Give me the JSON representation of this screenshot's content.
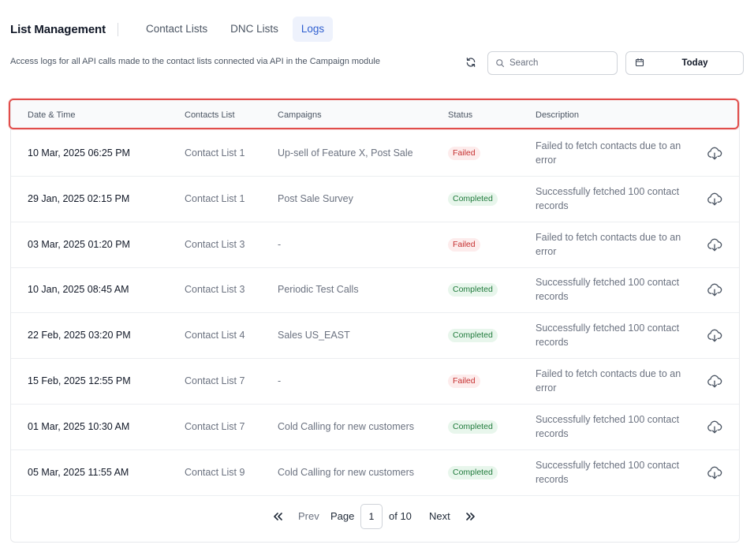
{
  "header": {
    "title": "List Management",
    "tabs": [
      {
        "label": "Contact Lists",
        "active": false
      },
      {
        "label": "DNC Lists",
        "active": false
      },
      {
        "label": "Logs",
        "active": true
      }
    ]
  },
  "subtitle": "Access logs for all API calls made to the contact lists connected via API in the Campaign module",
  "toolbar": {
    "refresh_icon": "refresh-icon",
    "search": {
      "placeholder": "Search",
      "value": ""
    },
    "date_filter": {
      "label": "Today"
    }
  },
  "table": {
    "columns": [
      "Date & Time",
      "Contacts List",
      "Campaigns",
      "Status",
      "Description"
    ],
    "rows": [
      {
        "datetime": "10 Mar, 2025 06:25 PM",
        "list": "Contact List 1",
        "campaigns": "Up-sell of Feature X, Post Sale",
        "status": "Failed",
        "description": "Failed to fetch contacts due to an error"
      },
      {
        "datetime": "29 Jan, 2025 02:15 PM",
        "list": "Contact List 1",
        "campaigns": "Post Sale Survey",
        "status": "Completed",
        "description": "Successfully fetched 100 contact records"
      },
      {
        "datetime": "03 Mar, 2025 01:20 PM",
        "list": "Contact List 3",
        "campaigns": "-",
        "status": "Failed",
        "description": "Failed to fetch contacts due to an error"
      },
      {
        "datetime": "10 Jan, 2025 08:45 AM",
        "list": "Contact List 3",
        "campaigns": "Periodic Test Calls",
        "status": "Completed",
        "description": "Successfully fetched 100 contact records"
      },
      {
        "datetime": "22 Feb, 2025 03:20 PM",
        "list": "Contact List 4",
        "campaigns": "Sales US_EAST",
        "status": "Completed",
        "description": "Successfully fetched 100 contact records"
      },
      {
        "datetime": "15 Feb, 2025 12:55 PM",
        "list": "Contact List 7",
        "campaigns": "-",
        "status": "Failed",
        "description": "Failed to fetch contacts due to an error"
      },
      {
        "datetime": "01 Mar, 2025 10:30 AM",
        "list": "Contact List 7",
        "campaigns": "Cold Calling for new customers",
        "status": "Completed",
        "description": "Successfully fetched 100 contact records"
      },
      {
        "datetime": "05 Mar, 2025 11:55 AM",
        "list": "Contact List 9",
        "campaigns": "Cold Calling for new customers",
        "status": "Completed",
        "description": "Successfully fetched 100 contact records"
      }
    ]
  },
  "pagination": {
    "prev_label": "Prev",
    "page_label": "Page",
    "current_page": "1",
    "of_label": "of 10",
    "next_label": "Next"
  },
  "colors": {
    "accent": "#2f5fd0",
    "failed": "#c53030",
    "completed": "#1f7a3b",
    "highlight": "#e14d4a"
  }
}
